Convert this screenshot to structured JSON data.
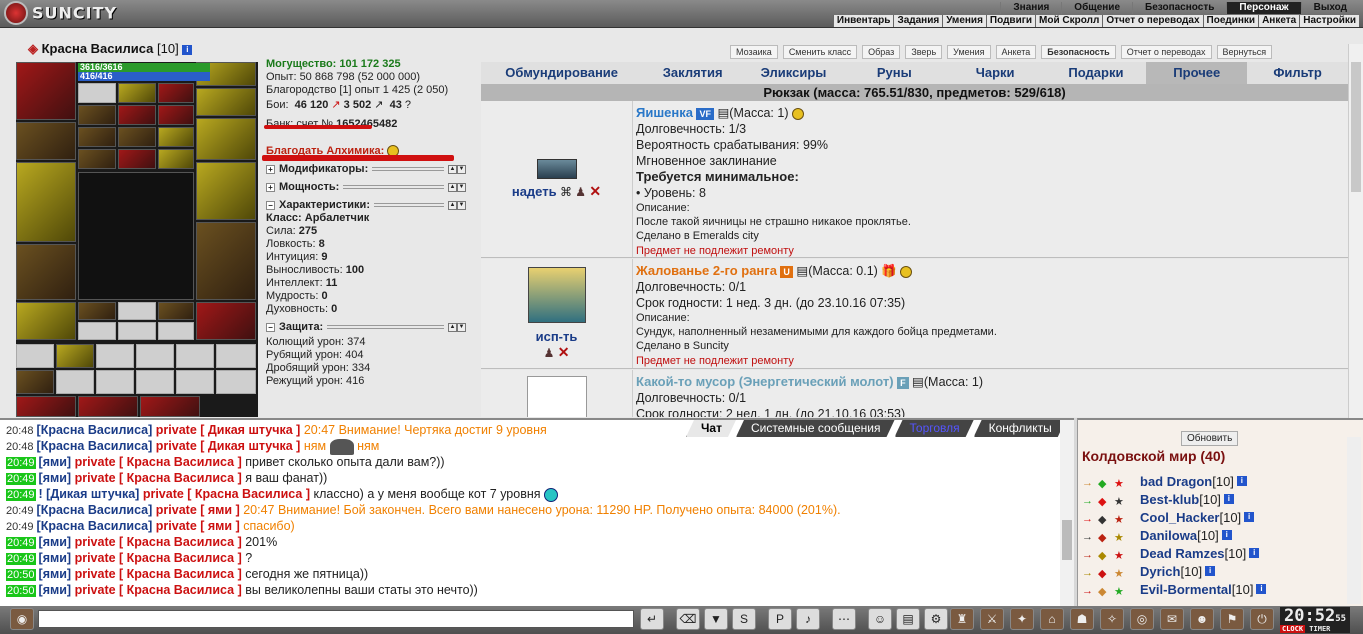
{
  "app": {
    "logo": "SUNCITY"
  },
  "top_menu": [
    "Знания",
    "Общение",
    "Безопасность",
    "Персонаж",
    "Выход"
  ],
  "top_menu_active": "Персонаж",
  "sub_menu": [
    "Инвентарь",
    "Задания",
    "Умения",
    "Подвиги",
    "Мой Скролл",
    "Отчет о переводах",
    "Поединки",
    "Анкета",
    "Настройки"
  ],
  "character": {
    "name": "Красна Василиса",
    "level": "[10]",
    "hp": "3616/3616",
    "mp": "416/416"
  },
  "tool_buttons": [
    "Мозаика",
    "Сменить класс",
    "Образ",
    "Зверь",
    "Умения",
    "Анкета",
    "Безопасность",
    "Отчет о переводах",
    "Вернуться"
  ],
  "stats": {
    "power": "Могущество: 101 172 325",
    "exp": "Опыт: 50 868 798 (52 000 000)",
    "nobility": "Благородство [1] опыт 1 425 (2 050)",
    "battles_label": "Бои:",
    "battles": "46 120",
    "wins": "3 502",
    "draws": "43",
    "bank_label": "Банк: счет №",
    "bank": "1652465482",
    "alchemist": "Благодать Алхимика:",
    "sec_mod": "Модификаторы:",
    "sec_pow": "Мощность:",
    "sec_char": "Характеристики:",
    "class": "Класс: Арбалетчик",
    "strength_l": "Сила:",
    "strength": "275",
    "agility_l": "Ловкость:",
    "agility": "8",
    "intuition_l": "Интуиция:",
    "intuition": "9",
    "endurance_l": "Выносливость:",
    "endurance": "100",
    "intellect_l": "Интеллект:",
    "intellect": "11",
    "wisdom_l": "Мудрость:",
    "wisdom": "0",
    "spirit_l": "Духовность:",
    "spirit": "0",
    "sec_def": "Защита:",
    "def1": "Колющий урон: 374",
    "def2": "Рубящий урон: 404",
    "def3": "Дробящий урон: 334",
    "def4": "Режущий урон: 416"
  },
  "inv_tabs": [
    "Обмундирование",
    "Заклятия",
    "Эликсиры",
    "Руны",
    "Чарки",
    "Подарки",
    "Прочее",
    "Фильтр"
  ],
  "inv_tab_active": "Прочее",
  "bag_title": "Рюкзак (масса: 765.51/830, предметов: 529/618)",
  "items": [
    {
      "action": "надеть",
      "name": "Яишенка",
      "tag": "VF",
      "mass": "(Масса: 1)",
      "l1": "Долговечность: 1/3",
      "l2": "Вероятность срабатывания: 99%",
      "l3": "Мгновенное заклинание",
      "req": "Требуется минимальное:",
      "req1": "• Уровень: 8",
      "d0": "Описание:",
      "d1": "После такой яичницы не страшно никакое проклятье.",
      "d2": "Сделано в Emeralds city",
      "nr": "Предмет не подлежит ремонту"
    },
    {
      "action": "исп-ть",
      "name": "Жалованье 2-го ранга",
      "tag": "U",
      "mass": "(Масса: 0.1)",
      "l1": "Долговечность: 0/1",
      "l2": "Срок годности: 1 нед. 3 дн. (до 23.10.16 07:35)",
      "d0": "Описание:",
      "d1": "Сундук, наполненный незаменимыми для каждого бойца предметами.",
      "d2": "Сделано в Suncity",
      "nr": "Предмет не подлежит ремонту"
    },
    {
      "name": "Какой-то мусор (Энергетический молот)",
      "tag": "F",
      "mass": "(Масса: 1)",
      "l1": "Долговечность: 0/1",
      "l2": "Срок годности: 2 нед. 1 дн. (до 21.10.16 03:53)"
    }
  ],
  "chat_tabs": [
    "Чат",
    "Системные сообщения",
    "Торговля",
    "Конфликты"
  ],
  "chat": [
    {
      "t": "20:48",
      "g": false,
      "a": "[Красна Василиса]",
      "p": "private [ Дикая штучка ]",
      "m": "20:47 Внимание! Чертяка достиг 9 уровня",
      "o": true
    },
    {
      "t": "20:48",
      "g": false,
      "a": "[Красна Василиса]",
      "p": "private [ Дикая штучка ]",
      "m": "ням",
      "m2": "ням",
      "o": true,
      "cat": true
    },
    {
      "t": "20:49",
      "g": true,
      "a": "[ями]",
      "p": "private [ Красна Василиса ]",
      "m": "привет сколько опыта дали вам?))"
    },
    {
      "t": "20:49",
      "g": true,
      "a": "[ями]",
      "p": "private [ Красна Василиса ]",
      "m": "я ваш фанат))"
    },
    {
      "t": "20:49",
      "g": true,
      "a": "! [Дикая штучка]",
      "p": "private [ Красна Василиса ]",
      "m": "классно) а у меня вообще кот 7 уровня",
      "smile": true
    },
    {
      "t": "20:49",
      "g": false,
      "a": "[Красна Василиса]",
      "p": "private [ ями ]",
      "m": "20:47 Внимание! Бой закончен. Всего вами нанесено урона: 11290 HP. Получено опыта: 84000 (201%).",
      "o": true
    },
    {
      "t": "20:49",
      "g": false,
      "a": "[Красна Василиса]",
      "p": "private [ ями ]",
      "m": "спасибо)",
      "o": true
    },
    {
      "t": "20:49",
      "g": true,
      "a": "[ями]",
      "p": "private [ Красна Василиса ]",
      "m": "201%"
    },
    {
      "t": "20:49",
      "g": true,
      "a": "[ями]",
      "p": "private [ Красна Василиса ]",
      "m": "?"
    },
    {
      "t": "20:50",
      "g": true,
      "a": "[ями]",
      "p": "private [ Красна Василиса ]",
      "m": "сегодня же пятница))"
    },
    {
      "t": "20:50",
      "g": true,
      "a": "[ями]",
      "p": "private [ Красна Василиса ]",
      "m": "вы великолепны ваши статы это нечто))"
    }
  ],
  "users_panel": {
    "refresh": "Обновить",
    "world": "Колдовской мир (40)"
  },
  "users": [
    {
      "n": "bad Dragon",
      "l": "[10]"
    },
    {
      "n": "Best-klub",
      "l": "[10]"
    },
    {
      "n": "Cool_Hacker",
      "l": "[10]"
    },
    {
      "n": "Danilowa",
      "l": "[10]"
    },
    {
      "n": "Dead Ramzes",
      "l": "[10]"
    },
    {
      "n": "Dyrich",
      "l": "[10]"
    },
    {
      "n": "Evil-Bormental",
      "l": "[10]"
    }
  ],
  "clock": {
    "time": "20:52",
    "sec": "55",
    "c1": "CLOCK",
    "c2": "TIMER"
  },
  "colors": {
    "accent": "#1a3c88",
    "private": "#cc1010",
    "system": "#f08000",
    "green_time": "#19c619"
  }
}
